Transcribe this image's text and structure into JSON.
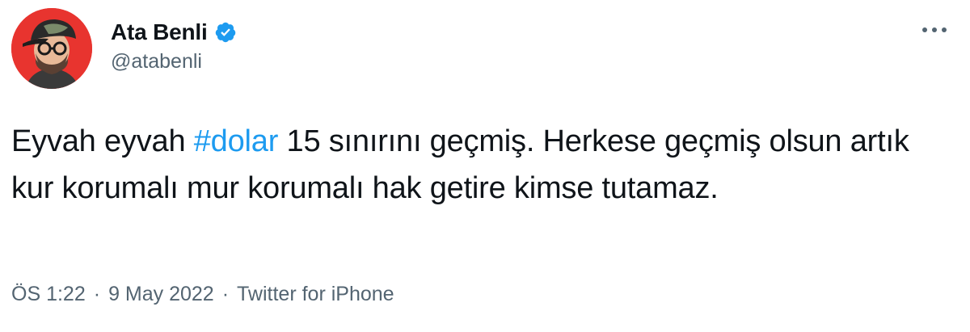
{
  "user": {
    "display_name": "Ata Benli",
    "handle": "@atabenli",
    "verified": true
  },
  "tweet": {
    "text_before": "Eyvah eyvah ",
    "hashtag": "#dolar",
    "text_after": " 15 sınırını geçmiş. Herkese geçmiş olsun artık kur korumalı mur korumalı hak getire kimse tutamaz."
  },
  "meta": {
    "time": "ÖS 1:22",
    "separator": "·",
    "date": "9 May 2022",
    "source": "Twitter for iPhone"
  },
  "colors": {
    "accent": "#1d9bf0",
    "text": "#0f1419",
    "secondary": "#536471",
    "avatar_bg": "#e8342f"
  },
  "icons": {
    "verified": "verified-badge-icon",
    "more": "more-options-icon"
  }
}
